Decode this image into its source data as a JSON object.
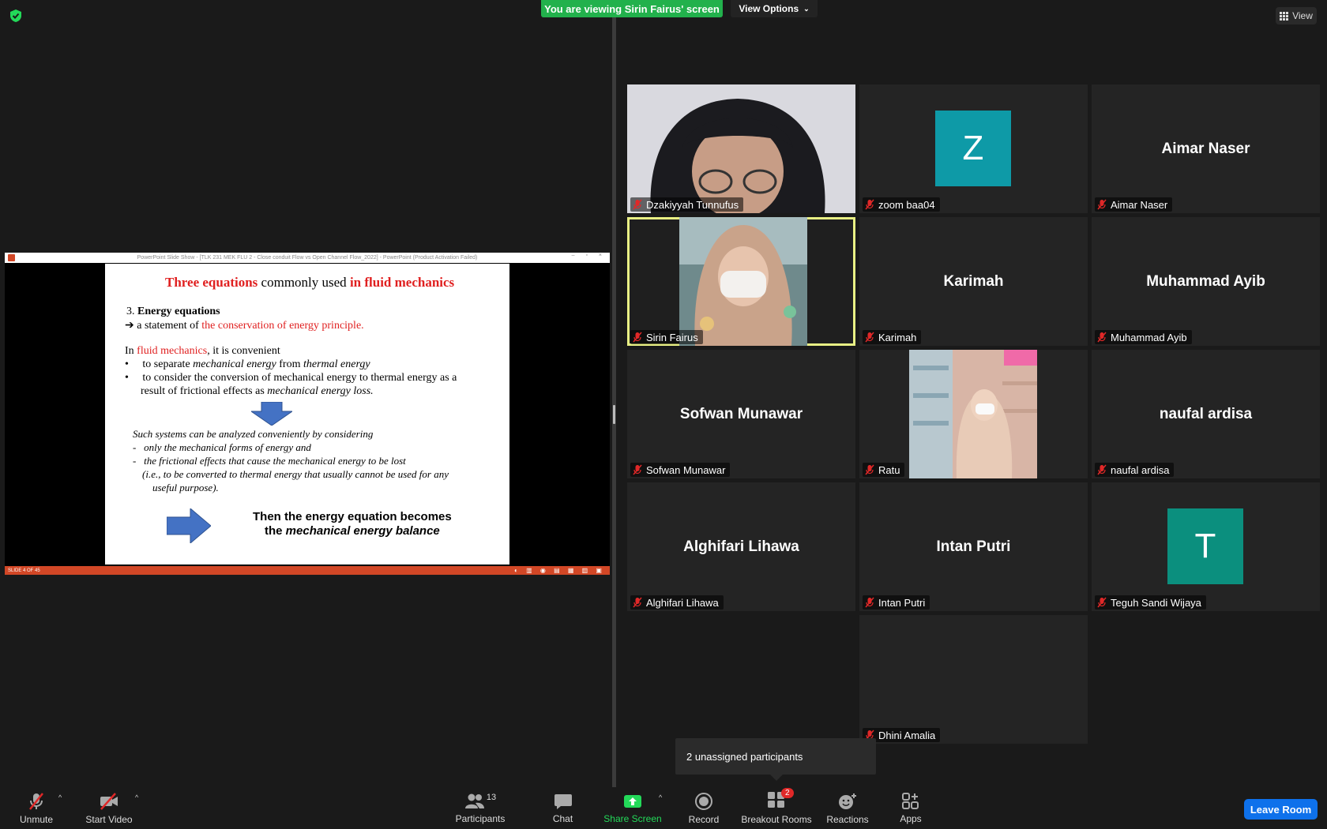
{
  "banner": {
    "viewing_text": "You are viewing Sirin Fairus' screen",
    "view_options_label": "View Options"
  },
  "view_button_label": "View",
  "slide": {
    "title_part1": "Three equations",
    "title_part2": " commonly used ",
    "title_part3": "in fluid mechanics",
    "line_3_num": "3. ",
    "line_3_bold": "Energy equations",
    "arrow_line_text": "a statement of ",
    "arrow_line_red": "the conservation of energy principle.",
    "in_text": "In ",
    "in_red": "fluid mechanics",
    "in_rest": ", it is convenient",
    "b1_a": "to separate ",
    "b1_i1": "mechanical energy",
    "b1_b": " from ",
    "b1_i2": "thermal energy",
    "b2_a": "to consider the conversion of mechanical energy to thermal energy as a",
    "b2_b": "result of frictional effects as ",
    "b2_i": "mechanical energy loss.",
    "such1": "Such systems can be analyzed conveniently by considering",
    "such2": "only the mechanical forms of energy and",
    "such3": "the frictional effects that cause the mechanical energy to be lost",
    "such4": "(i.e., to be converted to thermal energy that usually cannot be used for any",
    "such5": "useful purpose).",
    "then1": "Then the energy equation becomes",
    "then2a": "the ",
    "then2b": "mechanical energy balance"
  },
  "ppt": {
    "titlebar": "PowerPoint Slide Show - [TLK 231 MEK FLU 2 - Close conduit Flow vs Open Channel Flow_2022] - PowerPoint (Product Activation Failed)",
    "status": "SLIDE 4 OF 45"
  },
  "participants": [
    {
      "name": "Dzakiyyah Tunnufus",
      "display": ""
    },
    {
      "name": "zoom baa04",
      "display": "Z",
      "avatar_color": "#0e9aa7"
    },
    {
      "name": "Aimar Naser",
      "display": "Aimar Naser"
    },
    {
      "name": "Sirin Fairus",
      "display": ""
    },
    {
      "name": "Karimah",
      "display": "Karimah"
    },
    {
      "name": "Muhammad Ayib",
      "display": "Muhammad Ayib"
    },
    {
      "name": "Sofwan Munawar",
      "display": "Sofwan Munawar"
    },
    {
      "name": "Ratu",
      "display": ""
    },
    {
      "name": "naufal ardisa",
      "display": "naufal ardisa"
    },
    {
      "name": "Alghifari Lihawa",
      "display": "Alghifari Lihawa"
    },
    {
      "name": "Intan Putri",
      "display": "Intan Putri"
    },
    {
      "name": "Teguh Sandi Wijaya",
      "display": "T",
      "avatar_color": "#0b8f7e"
    },
    {
      "name": "Dhini Amalia",
      "display": ""
    }
  ],
  "tooltip": "2 unassigned participants",
  "toolbar": {
    "unmute": "Unmute",
    "start_video": "Start Video",
    "participants": "Participants",
    "participants_count": "13",
    "chat": "Chat",
    "share_screen": "Share Screen",
    "record": "Record",
    "breakout": "Breakout Rooms",
    "breakout_badge": "2",
    "reactions": "Reactions",
    "apps": "Apps",
    "leave": "Leave Room"
  }
}
